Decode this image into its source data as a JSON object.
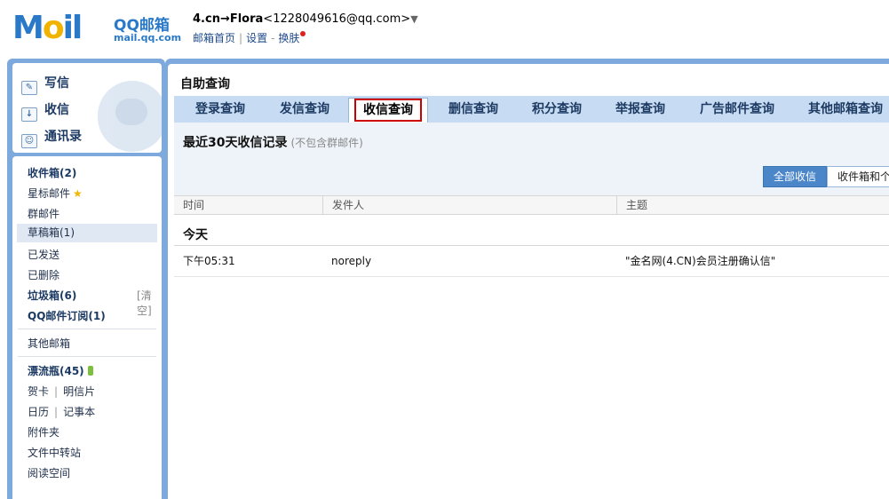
{
  "logo": {
    "mail_text": "MAIL",
    "brand_name": "QQ邮箱",
    "brand_domain": "mail.qq.com"
  },
  "account": {
    "name": "4.cn→Flora",
    "email": "<1228049616@qq.com>",
    "caret": "▼",
    "links": [
      "邮箱首页",
      "设置",
      "换肤"
    ]
  },
  "sidebar": {
    "quick_actions": [
      {
        "label": "写信",
        "icon": "compose-icon"
      },
      {
        "label": "收信",
        "icon": "inbox-download-icon"
      },
      {
        "label": "通讯录",
        "icon": "contacts-icon"
      }
    ],
    "folders": {
      "inbox": "收件箱(2)",
      "starred": "星标邮件",
      "group": "群邮件",
      "drafts": "草稿箱(1)",
      "sent": "已发送",
      "deleted": "已删除",
      "spam": "垃圾箱(6)",
      "spam_clear": "[清空]",
      "subscriptions": "QQ邮件订阅(1)",
      "other_mailbox": "其他邮箱",
      "drift_bottle": "漂流瓶(45)",
      "greeting_card": "贺卡",
      "postcard": "明信片",
      "calendar": "日历",
      "notebook": "记事本",
      "attachments": "附件夹",
      "file_transfer": "文件中转站",
      "reading_space": "阅读空间"
    }
  },
  "main": {
    "title": "自助查询",
    "tabs": [
      "登录查询",
      "发信查询",
      "收信查询",
      "删信查询",
      "积分查询",
      "举报查询",
      "广告邮件查询",
      "其他邮箱查询"
    ],
    "active_tab": "收信查询",
    "section_title": "最近30天收信记录",
    "section_note": "(不包含群邮件)",
    "filters": [
      "全部收信",
      "收件箱和个"
    ],
    "columns": [
      "时间",
      "发件人",
      "主题"
    ],
    "group_label": "今天",
    "rows": [
      {
        "time": "下午05:31",
        "sender": "noreply",
        "subject": "\"金名网(4.CN)会员注册确认信\""
      }
    ]
  },
  "colors": {
    "brand_blue": "#2a79c8",
    "frame_blue": "#7ea9dc",
    "tab_bar": "#c7dcf2",
    "active_filter": "#4a86c8",
    "highlight_border": "#cc0000"
  }
}
